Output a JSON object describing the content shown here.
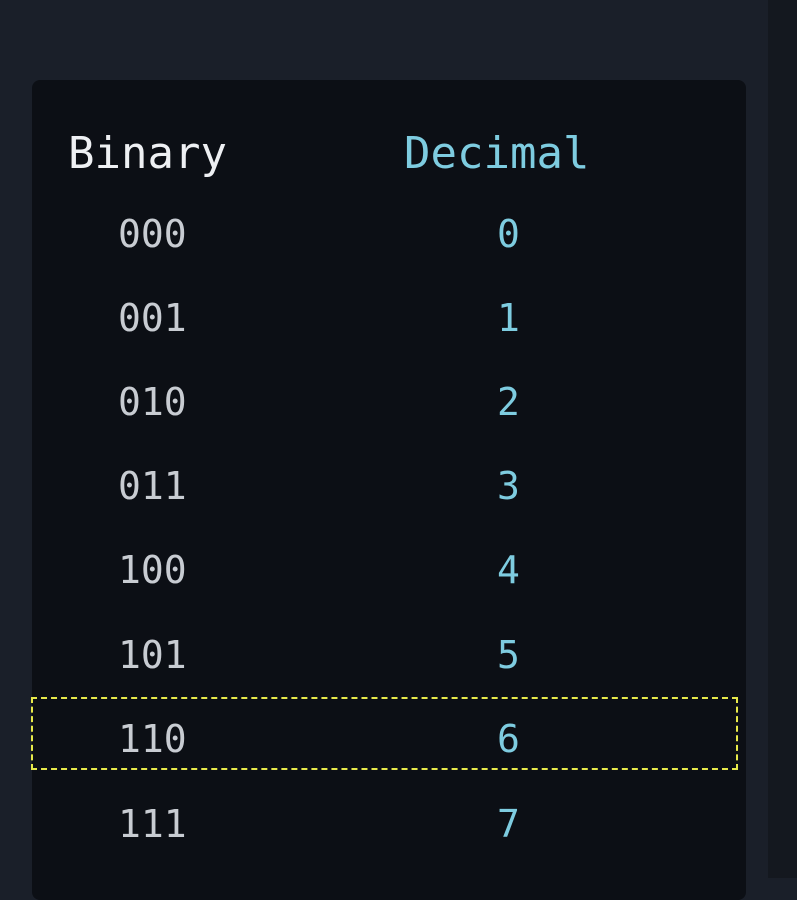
{
  "table": {
    "headers": {
      "binary": "Binary",
      "decimal": "Decimal"
    },
    "rows": [
      {
        "binary": "000",
        "decimal": "0"
      },
      {
        "binary": "001",
        "decimal": "1"
      },
      {
        "binary": "010",
        "decimal": "2"
      },
      {
        "binary": "011",
        "decimal": "3"
      },
      {
        "binary": "100",
        "decimal": "4"
      },
      {
        "binary": "101",
        "decimal": "5"
      },
      {
        "binary": "110",
        "decimal": "6"
      },
      {
        "binary": "111",
        "decimal": "7"
      }
    ],
    "highlighted_row": 6
  },
  "colors": {
    "background": "#1a1f29",
    "panel": "#0c0f15",
    "header_binary": "#eef0f3",
    "header_decimal": "#7ecce0",
    "binary_text": "#c8ccd2",
    "decimal_text": "#7ecce0",
    "highlight_border": "#e7e94a"
  }
}
